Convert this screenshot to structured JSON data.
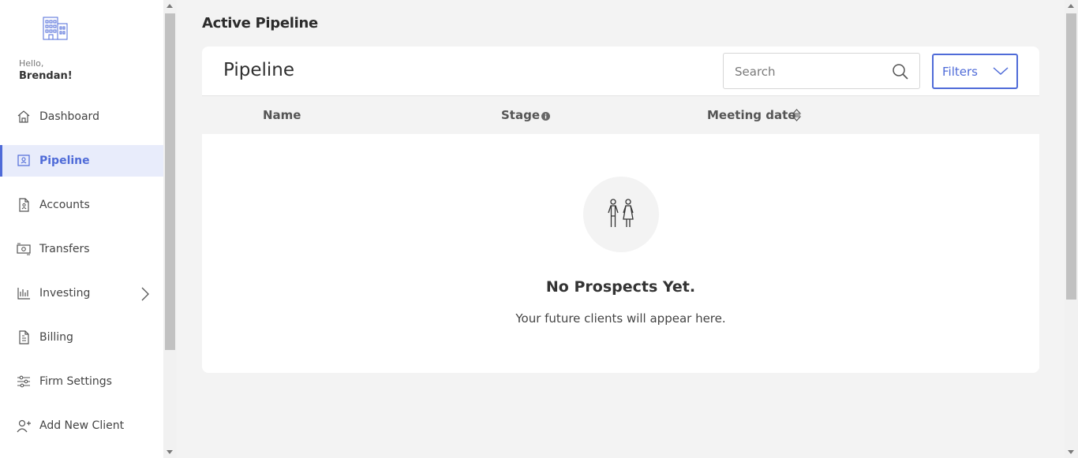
{
  "sidebar": {
    "greeting": "Hello,",
    "user_name": "Brendan!",
    "items": [
      {
        "label": "Dashboard",
        "icon": "home-icon"
      },
      {
        "label": "Pipeline",
        "icon": "pipeline-icon",
        "active": true
      },
      {
        "label": "Accounts",
        "icon": "document-icon"
      },
      {
        "label": "Transfers",
        "icon": "money-transfer-icon"
      },
      {
        "label": "Investing",
        "icon": "chart-icon"
      },
      {
        "label": "Billing",
        "icon": "billing-icon"
      },
      {
        "label": "Firm Settings",
        "icon": "sliders-icon"
      },
      {
        "label": "Add New Client",
        "icon": "add-user-icon"
      }
    ]
  },
  "main": {
    "page_title": "Active Pipeline",
    "card": {
      "title": "Pipeline",
      "search_placeholder": "Search",
      "filters_label": "Filters",
      "columns": [
        "Name",
        "Stage",
        "Meeting date"
      ],
      "empty_title": "No Prospects Yet.",
      "empty_subtitle": "Your future clients will appear here."
    }
  },
  "colors": {
    "accent": "#4f6bd8",
    "active_bg": "#e8ecfb",
    "page_bg": "#f3f3f3"
  }
}
